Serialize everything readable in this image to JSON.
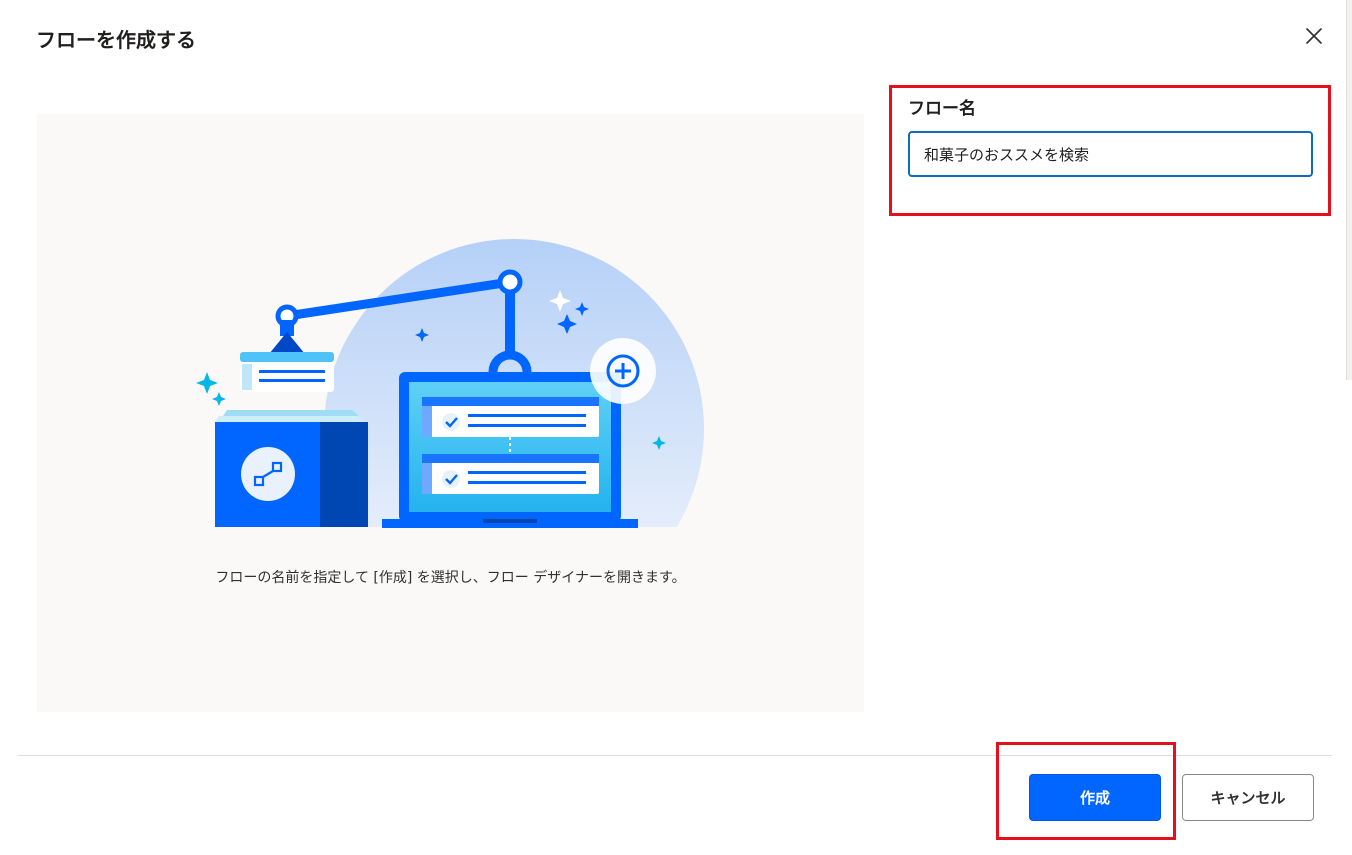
{
  "dialog": {
    "title": "フローを作成する",
    "close_icon": "close-icon"
  },
  "illustration": {
    "caption": "フローの名前を指定して [作成] を選択し、フロー デザイナーを開きます。"
  },
  "form": {
    "flow_name_label": "フロー名",
    "flow_name_value": "和菓子のおススメを検索"
  },
  "footer": {
    "create_label": "作成",
    "cancel_label": "キャンセル"
  },
  "colors": {
    "accent": "#0066ff",
    "highlight": "#e3101e",
    "input_border": "#0f6cbd",
    "panel_bg": "#faf9f8"
  }
}
